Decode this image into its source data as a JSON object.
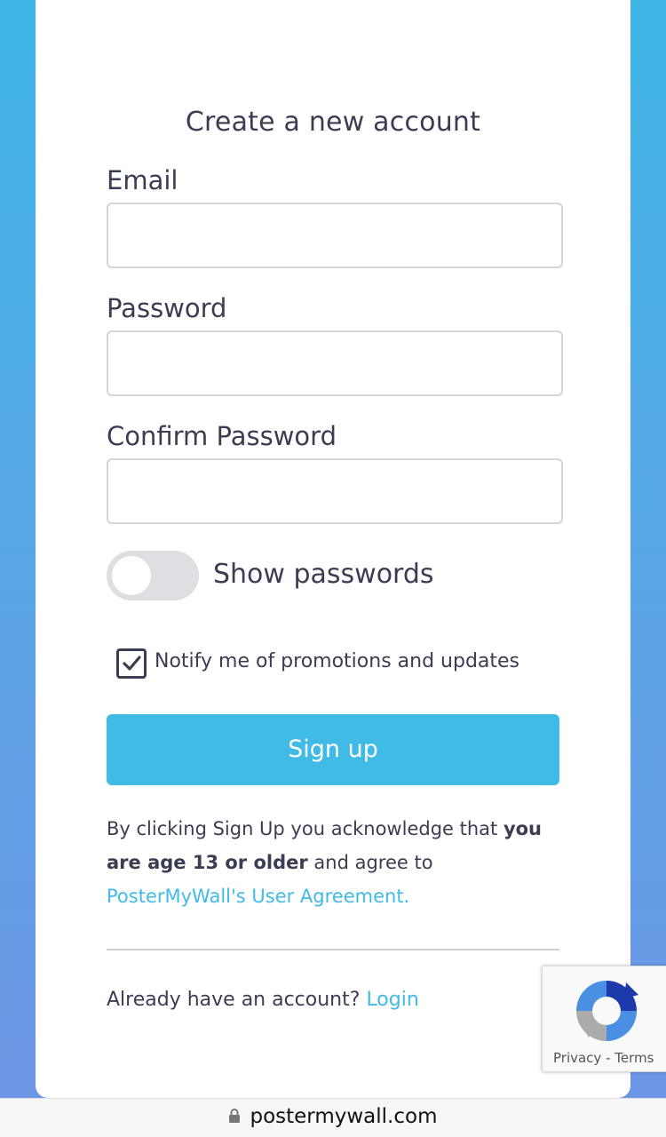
{
  "form": {
    "title": "Create a new account",
    "email_label": "Email",
    "email_value": "",
    "password_label": "Password",
    "password_value": "",
    "confirm_label": "Confirm Password",
    "confirm_value": "",
    "show_passwords_label": "Show passwords",
    "show_passwords_on": false,
    "notify_label": "Notify me of promotions and updates",
    "notify_checked": true,
    "signup_label": "Sign up",
    "legal_pre": "By clicking Sign Up you acknowledge that ",
    "legal_bold": "you are age 13 or older",
    "legal_mid": " and agree to ",
    "legal_link": "PosterMyWall's User Agreement.",
    "already_text": "Already have an account? ",
    "login_link": "Login"
  },
  "recaptcha": {
    "privacy": "Privacy",
    "separator": "-",
    "terms": "Terms"
  },
  "browser": {
    "url": "postermywall.com"
  },
  "colors": {
    "accent": "#3fbbe6",
    "text": "#3b3d52"
  },
  "icons": {
    "checkbox_check": "check-icon",
    "recaptcha_logo": "recaptcha-logo-icon",
    "url_lock": "lock-icon"
  }
}
